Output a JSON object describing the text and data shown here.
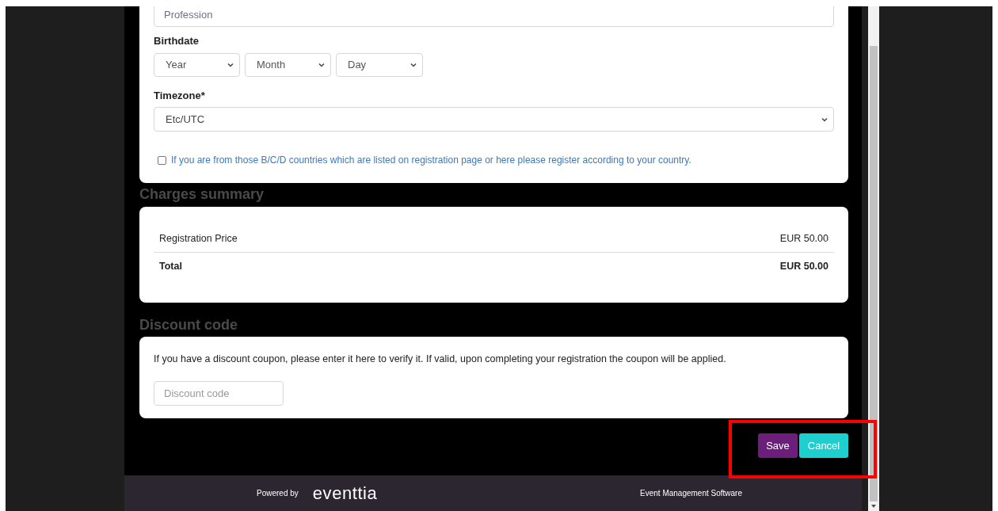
{
  "profile_form": {
    "profession": {
      "placeholder": "Profession"
    },
    "birthdate": {
      "label": "Birthdate",
      "selects": [
        {
          "value": "Year"
        },
        {
          "value": "Month"
        },
        {
          "value": "Day"
        }
      ]
    },
    "timezone": {
      "label": "Timezone*",
      "value": "Etc/UTC"
    },
    "country_notice": {
      "checked": false,
      "label": "If you are from those B/C/D countries which are listed on registration page or here please register according to your country."
    }
  },
  "charges_summary": {
    "title": "Charges summary",
    "rows": [
      {
        "kind": "item",
        "label": "Registration Price",
        "amount": "EUR 50.00"
      },
      {
        "kind": "total",
        "label": "Total",
        "amount": "EUR 50.00"
      }
    ]
  },
  "discount": {
    "title": "Discount code",
    "text": "If you have a discount coupon, please enter it here to verify it. If valid, upon completing your registration the coupon will be applied.",
    "placeholder": "Discount code"
  },
  "buttons": [
    {
      "kind": "primary",
      "label": "Save"
    },
    {
      "kind": "secondary",
      "label": "Cancel"
    }
  ],
  "footer": {
    "powered_by": "Powered by",
    "brand": "eventtia",
    "tagline": "Event Management Software"
  }
}
